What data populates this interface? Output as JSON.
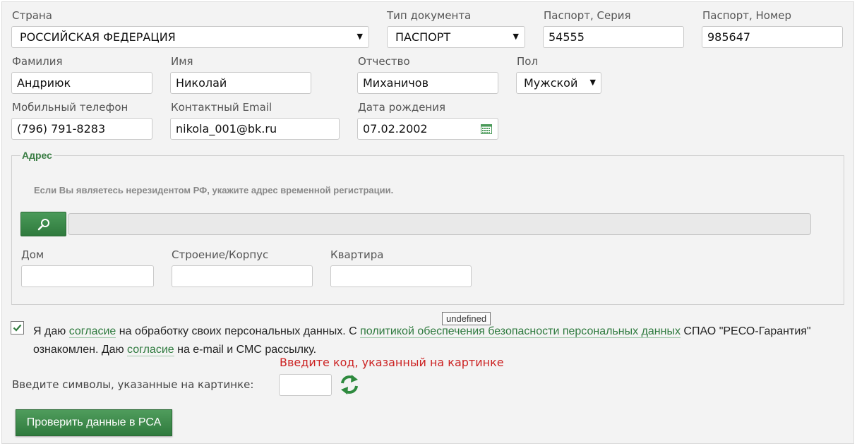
{
  "passport": {
    "country_label": "Страна",
    "country_value": "РОССИЙСКАЯ ФЕДЕРАЦИЯ",
    "doc_type_label": "Тип документа",
    "doc_type_value": "ПАСПОРТ",
    "series_label": "Паспорт, Серия",
    "series_value": "54555",
    "number_label": "Паспорт, Номер",
    "number_value": "985647"
  },
  "person": {
    "surname_label": "Фамилия",
    "surname_value": "Андриюк",
    "name_label": "Имя",
    "name_value": "Николай",
    "patronymic_label": "Отчество",
    "patronymic_value": "Миханичов",
    "gender_label": "Пол",
    "gender_value": "Мужской"
  },
  "contacts": {
    "phone_label": "Мобильный телефон",
    "phone_value": "(796) 791-8283",
    "email_label": "Контактный Email",
    "email_value": "nikola_001@bk.ru",
    "birthdate_label": "Дата рождения",
    "birthdate_value": "07.02.2002"
  },
  "address": {
    "legend": "Адрес",
    "hint": "Если Вы являетесь нерезидентом РФ, укажите адрес временной регистрации.",
    "house_label": "Дом",
    "building_label": "Строение/Корпус",
    "apartment_label": "Квартира",
    "search_icon": "magnifier-icon"
  },
  "consent": {
    "checked": true,
    "t1": "Я даю ",
    "link1": "согласие",
    "t2": " на обработку своих персональных данных. С ",
    "link2": "политикой обеспечения безопасности персональных данных",
    "t3": " СПАО \"РЕСО-Гарантия\" ознакомлен. Даю ",
    "link3": "согласие",
    "t4": " на e-mail и СМС рассылку.",
    "tooltip": "undefined"
  },
  "captcha": {
    "error": "Введите код, указанный на картинке",
    "label": "Введите символы, указанные на картинке:",
    "refresh_icon": "refresh-icon"
  },
  "submit_label": "Проверить данные в РСА",
  "colors": {
    "accent": "#2f7a3d",
    "link": "#2e7a3e",
    "error": "#cc2222"
  }
}
